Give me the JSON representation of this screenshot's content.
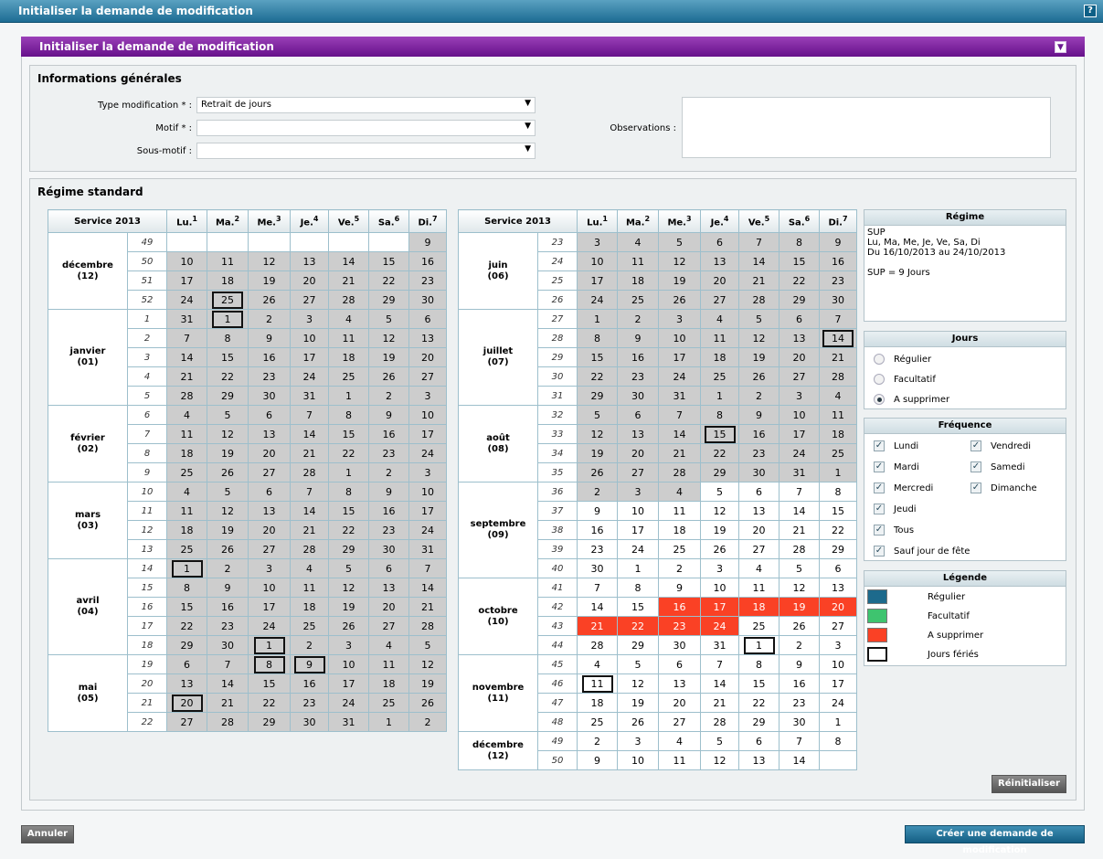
{
  "window_title": "Initialiser la demande de modification",
  "help_label": "?",
  "panel": {
    "title": "Initialiser la demande de modification",
    "collapse_label": "▼"
  },
  "info": {
    "title": "Informations générales",
    "type_label": "Type modification * :",
    "type_value": "Retrait de jours",
    "motif_label": "Motif * :",
    "motif_value": "",
    "sousmotif_label": "Sous-motif :",
    "sousmotif_value": "",
    "obs_label": "Observations :"
  },
  "regime_std_title": "Régime standard",
  "weekdays": [
    [
      "Lu.",
      "1"
    ],
    [
      "Ma.",
      "2"
    ],
    [
      "Me.",
      "3"
    ],
    [
      "Je.",
      "4"
    ],
    [
      "Ve.",
      "5"
    ],
    [
      "Sa.",
      "6"
    ],
    [
      "Di.",
      "7"
    ]
  ],
  "service_label": "Service 2013",
  "calendar_left": [
    {
      "month": "décembre",
      "num": "(12)",
      "weeks": [
        [
          "49",
          "",
          "",
          "",
          "",
          "",
          "",
          "g9"
        ],
        [
          "50",
          "g10",
          "g11",
          "g12",
          "g13",
          "g14",
          "g15",
          "g16"
        ],
        [
          "51",
          "g17",
          "g18",
          "g19",
          "g20",
          "g21",
          "g22",
          "g23"
        ],
        [
          "52",
          "g24",
          "gh25",
          "g26",
          "g27",
          "g28",
          "g29",
          "g30"
        ]
      ]
    },
    {
      "month": "janvier",
      "num": "(01)",
      "weeks": [
        [
          "1",
          "g31",
          "gh1",
          "g2",
          "g3",
          "g4",
          "g5",
          "g6"
        ],
        [
          "2",
          "g7",
          "g8",
          "g9",
          "g10",
          "g11",
          "g12",
          "g13"
        ],
        [
          "3",
          "g14",
          "g15",
          "g16",
          "g17",
          "g18",
          "g19",
          "g20"
        ],
        [
          "4",
          "g21",
          "g22",
          "g23",
          "g24",
          "g25",
          "g26",
          "g27"
        ],
        [
          "5",
          "g28",
          "g29",
          "g30",
          "g31",
          "g1",
          "g2",
          "g3"
        ]
      ]
    },
    {
      "month": "février",
      "num": "(02)",
      "weeks": [
        [
          "6",
          "g4",
          "g5",
          "g6",
          "g7",
          "g8",
          "g9",
          "g10"
        ],
        [
          "7",
          "g11",
          "g12",
          "g13",
          "g14",
          "g15",
          "g16",
          "g17"
        ],
        [
          "8",
          "g18",
          "g19",
          "g20",
          "g21",
          "g22",
          "g23",
          "g24"
        ],
        [
          "9",
          "g25",
          "g26",
          "g27",
          "g28",
          "g1",
          "g2",
          "g3"
        ]
      ]
    },
    {
      "month": "mars",
      "num": "(03)",
      "weeks": [
        [
          "10",
          "g4",
          "g5",
          "g6",
          "g7",
          "g8",
          "g9",
          "g10"
        ],
        [
          "11",
          "g11",
          "g12",
          "g13",
          "g14",
          "g15",
          "g16",
          "g17"
        ],
        [
          "12",
          "g18",
          "g19",
          "g20",
          "g21",
          "g22",
          "g23",
          "g24"
        ],
        [
          "13",
          "g25",
          "g26",
          "g27",
          "g28",
          "g29",
          "g30",
          "g31"
        ]
      ]
    },
    {
      "month": "avril",
      "num": "(04)",
      "weeks": [
        [
          "14",
          "gh1",
          "g2",
          "g3",
          "g4",
          "g5",
          "g6",
          "g7"
        ],
        [
          "15",
          "g8",
          "g9",
          "g10",
          "g11",
          "g12",
          "g13",
          "g14"
        ],
        [
          "16",
          "g15",
          "g16",
          "g17",
          "g18",
          "g19",
          "g20",
          "g21"
        ],
        [
          "17",
          "g22",
          "g23",
          "g24",
          "g25",
          "g26",
          "g27",
          "g28"
        ],
        [
          "18",
          "g29",
          "g30",
          "gh1",
          "g2",
          "g3",
          "g4",
          "g5"
        ]
      ]
    },
    {
      "month": "mai",
      "num": "(05)",
      "weeks": [
        [
          "19",
          "g6",
          "g7",
          "gh8",
          "gh9",
          "g10",
          "g11",
          "g12"
        ],
        [
          "20",
          "g13",
          "g14",
          "g15",
          "g16",
          "g17",
          "g18",
          "g19"
        ],
        [
          "21",
          "gh20",
          "g21",
          "g22",
          "g23",
          "g24",
          "g25",
          "g26"
        ],
        [
          "22",
          "g27",
          "g28",
          "g29",
          "g30",
          "g31",
          "g1",
          "g2"
        ]
      ]
    }
  ],
  "calendar_right": [
    {
      "month": "juin",
      "num": "(06)",
      "weeks": [
        [
          "23",
          "g3",
          "g4",
          "g5",
          "g6",
          "g7",
          "g8",
          "g9"
        ],
        [
          "24",
          "g10",
          "g11",
          "g12",
          "g13",
          "g14",
          "g15",
          "g16"
        ],
        [
          "25",
          "g17",
          "g18",
          "g19",
          "g20",
          "g21",
          "g22",
          "g23"
        ],
        [
          "26",
          "g24",
          "g25",
          "g26",
          "g27",
          "g28",
          "g29",
          "g30"
        ]
      ]
    },
    {
      "month": "juillet",
      "num": "(07)",
      "weeks": [
        [
          "27",
          "g1",
          "g2",
          "g3",
          "g4",
          "g5",
          "g6",
          "g7"
        ],
        [
          "28",
          "g8",
          "g9",
          "g10",
          "g11",
          "g12",
          "g13",
          "gh14"
        ],
        [
          "29",
          "g15",
          "g16",
          "g17",
          "g18",
          "g19",
          "g20",
          "g21"
        ],
        [
          "30",
          "g22",
          "g23",
          "g24",
          "g25",
          "g26",
          "g27",
          "g28"
        ],
        [
          "31",
          "g29",
          "g30",
          "g31",
          "g1",
          "g2",
          "g3",
          "g4"
        ]
      ]
    },
    {
      "month": "août",
      "num": "(08)",
      "weeks": [
        [
          "32",
          "g5",
          "g6",
          "g7",
          "g8",
          "g9",
          "g10",
          "g11"
        ],
        [
          "33",
          "g12",
          "g13",
          "g14",
          "gh15",
          "g16",
          "g17",
          "g18"
        ],
        [
          "34",
          "g19",
          "g20",
          "g21",
          "g22",
          "g23",
          "g24",
          "g25"
        ],
        [
          "35",
          "g26",
          "g27",
          "g28",
          "g29",
          "g30",
          "g31",
          "g1"
        ]
      ]
    },
    {
      "month": "septembre",
      "num": "(09)",
      "weeks": [
        [
          "36",
          "g2",
          "g3",
          "g4",
          "w5",
          "w6",
          "w7",
          "w8"
        ],
        [
          "37",
          "w9",
          "w10",
          "w11",
          "w12",
          "w13",
          "w14",
          "w15"
        ],
        [
          "38",
          "w16",
          "w17",
          "w18",
          "w19",
          "w20",
          "w21",
          "w22"
        ],
        [
          "39",
          "w23",
          "w24",
          "w25",
          "w26",
          "w27",
          "w28",
          "w29"
        ],
        [
          "40",
          "w30",
          "w1",
          "w2",
          "w3",
          "w4",
          "w5",
          "w6"
        ]
      ]
    },
    {
      "month": "octobre",
      "num": "(10)",
      "weeks": [
        [
          "41",
          "w7",
          "w8",
          "w9",
          "w10",
          "w11",
          "w12",
          "w13"
        ],
        [
          "42",
          "w14",
          "w15",
          "r16",
          "r17",
          "r18",
          "r19",
          "r20"
        ],
        [
          "43",
          "r21",
          "r22",
          "r23",
          "r24",
          "w25",
          "w26",
          "w27"
        ],
        [
          "44",
          "w28",
          "w29",
          "w30",
          "w31",
          "wh1",
          "w2",
          "w3"
        ]
      ]
    },
    {
      "month": "novembre",
      "num": "(11)",
      "weeks": [
        [
          "45",
          "w4",
          "w5",
          "w6",
          "w7",
          "w8",
          "w9",
          "w10"
        ],
        [
          "46",
          "wh11",
          "w12",
          "w13",
          "w14",
          "w15",
          "w16",
          "w17"
        ],
        [
          "47",
          "w18",
          "w19",
          "w20",
          "w21",
          "w22",
          "w23",
          "w24"
        ],
        [
          "48",
          "w25",
          "w26",
          "w27",
          "w28",
          "w29",
          "w30",
          "w1"
        ]
      ]
    },
    {
      "month": "décembre",
      "num": "(12)",
      "weeks": [
        [
          "49",
          "w2",
          "w3",
          "w4",
          "w5",
          "w6",
          "w7",
          "w8"
        ],
        [
          "50",
          "w9",
          "w10",
          "w11",
          "w12",
          "w13",
          "w14",
          ""
        ]
      ]
    }
  ],
  "regime_box": {
    "title": "Régime",
    "lines": [
      "SUP",
      "Lu, Ma, Me, Je, Ve, Sa, Di",
      "Du 16/10/2013 au 24/10/2013",
      "",
      "SUP = 9 Jours"
    ]
  },
  "jours_box": {
    "title": "Jours",
    "options": [
      {
        "label": "Régulier",
        "checked": false
      },
      {
        "label": "Facultatif",
        "checked": false
      },
      {
        "label": "A supprimer",
        "checked": true
      }
    ]
  },
  "frequence_box": {
    "title": "Fréquence",
    "left": [
      "Lundi",
      "Mardi",
      "Mercredi",
      "Jeudi",
      "Tous",
      "Sauf jour de fête"
    ],
    "right": [
      "Vendredi",
      "Samedi",
      "Dimanche"
    ],
    "check": "✓"
  },
  "legende_box": {
    "title": "Légende",
    "items": [
      {
        "label": "Régulier",
        "color": "#1d6a8c"
      },
      {
        "label": "Facultatif",
        "color": "#3ec46f"
      },
      {
        "label": "A supprimer",
        "color": "#fa4125"
      },
      {
        "label": "Jours fériés",
        "color": "#ffffff"
      }
    ]
  },
  "buttons": {
    "reinit": "Réinitialiser",
    "annuler": "Annuler",
    "creer": "Créer une demande de modification"
  }
}
